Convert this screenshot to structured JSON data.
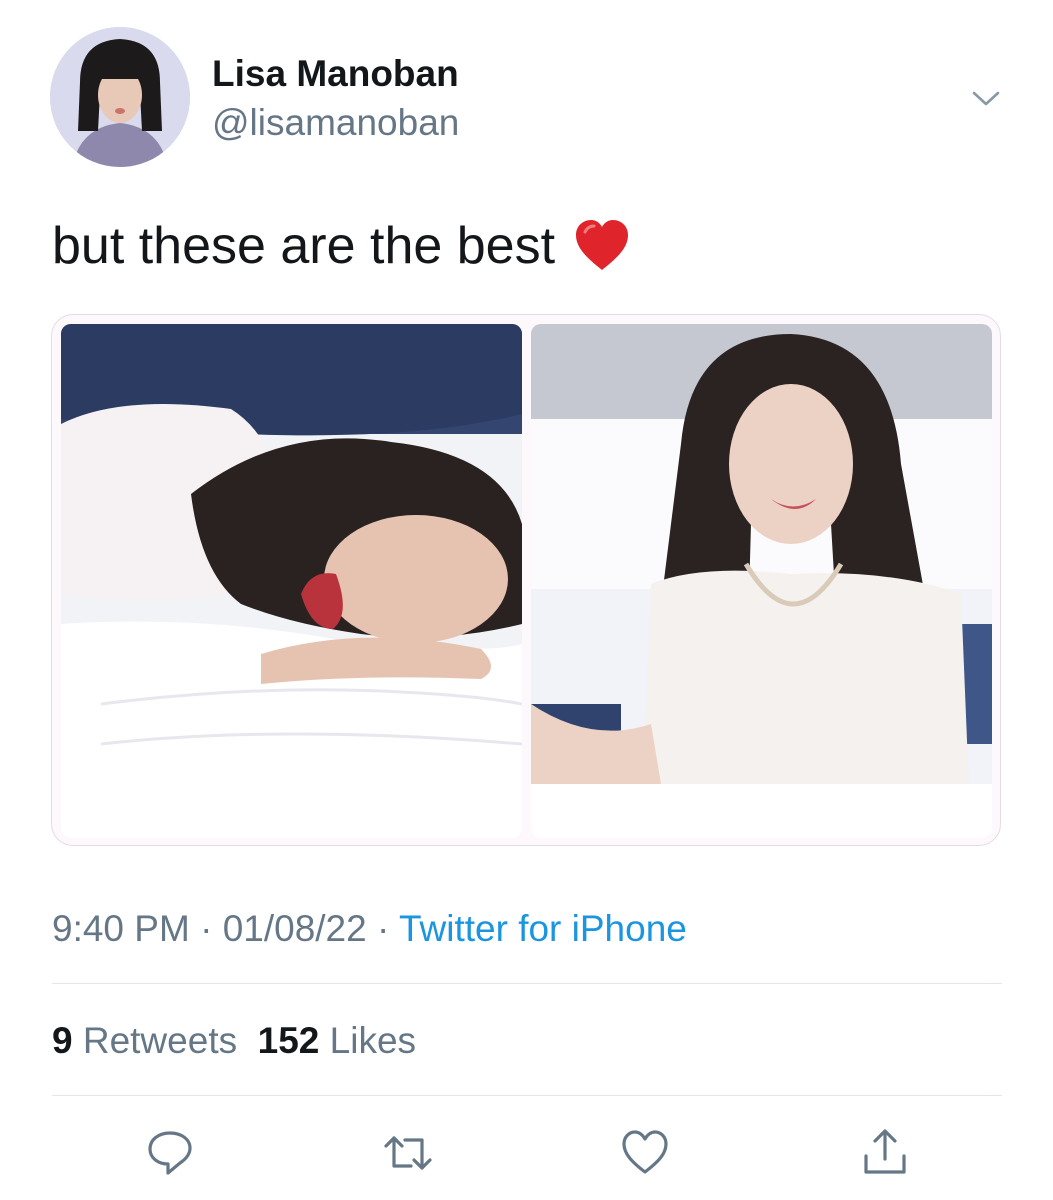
{
  "author": {
    "display_name": "Lisa Manoban",
    "handle": "@lisamanoban",
    "avatar_icon": "profile-photo"
  },
  "tweet": {
    "text": "but these are the best",
    "emoji_icon": "red-heart-emoji",
    "media": [
      {
        "icon": "photo-woman-laughing-on-pillow"
      },
      {
        "icon": "photo-woman-smiling-on-bed"
      }
    ]
  },
  "metadata": {
    "time": "9:40 PM",
    "separator": "·",
    "date": "01/08/22",
    "source": "Twitter for iPhone"
  },
  "stats": {
    "retweets_count": "9",
    "retweets_label": "Retweets",
    "likes_count": "152",
    "likes_label": "Likes"
  },
  "actions": [
    "reply-icon",
    "retweet-icon",
    "like-icon",
    "share-icon"
  ],
  "colors": {
    "text": "#14171a",
    "secondary": "#657786",
    "link": "#1b95e0",
    "divider": "#e1e8ed",
    "emoji": "#e0242c"
  }
}
